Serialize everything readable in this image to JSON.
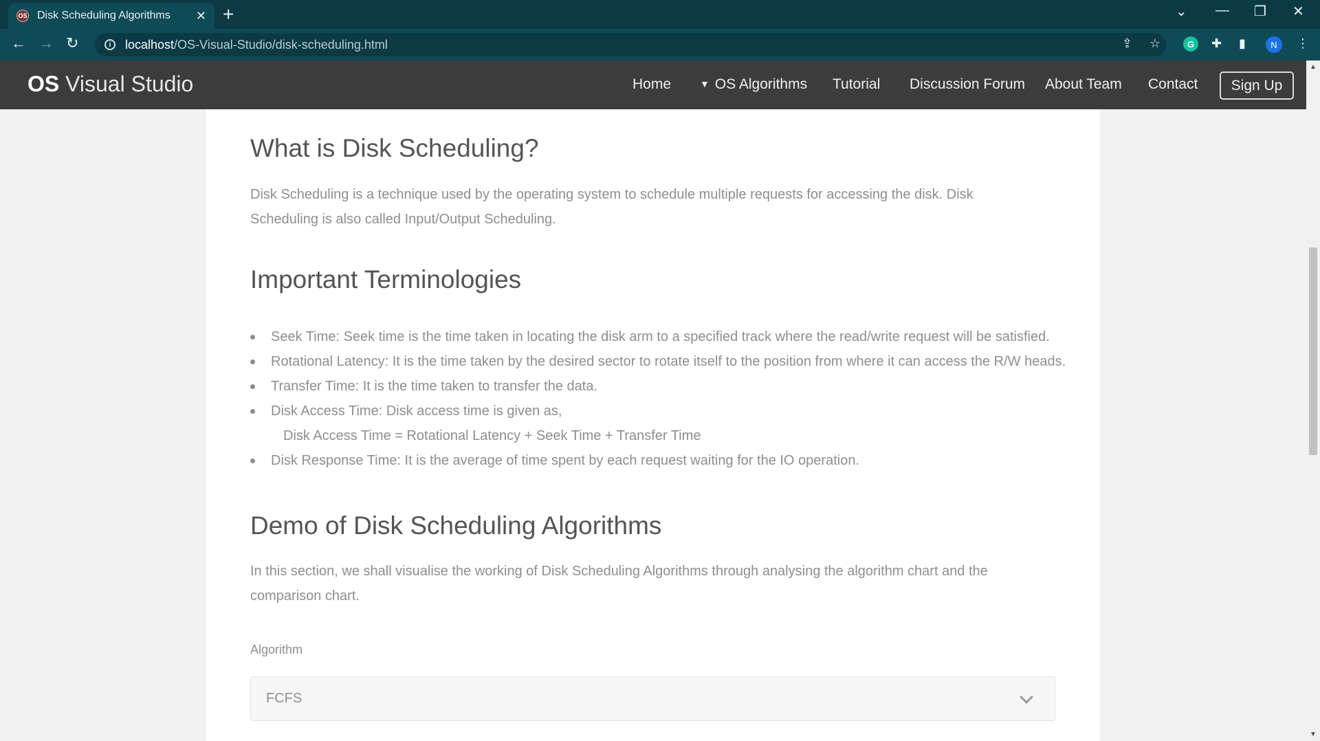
{
  "browser": {
    "tab_title": "Disk Scheduling Algorithms",
    "favicon_text": "OS",
    "url_host": "localhost",
    "url_path": "/OS-Visual-Studio/disk-scheduling.html",
    "grammarly_letter": "G",
    "profile_letter": "N"
  },
  "site": {
    "brand_bold": "OS",
    "brand_rest": " Visual Studio",
    "nav": {
      "home": "Home",
      "os_algorithms": "OS Algorithms",
      "tutorial": "Tutorial",
      "discussion": "Discussion Forum",
      "about": "About Team",
      "contact": "Contact",
      "signup": "Sign Up"
    }
  },
  "content": {
    "what_heading": "What is Disk Scheduling?",
    "what_text": "Disk Scheduling is a technique used by the operating system to schedule multiple requests for accessing the disk. Disk Scheduling is also called Input/Output Scheduling.",
    "terms_heading": "Important Terminologies",
    "terms": [
      "Seek Time: Seek time is the time taken in locating the disk arm to a specified track where the read/write request will be satisfied.",
      "Rotational Latency: It is the time taken by the desired sector to rotate itself to the position from where it can access the R/W heads.",
      "Transfer Time: It is the time taken to transfer the data.",
      "Disk Access Time: Disk access time is given as,",
      "Disk Access Time = Rotational Latency + Seek Time + Transfer Time",
      "Disk Response Time: It is the average of time spent by each request waiting for the IO operation."
    ],
    "demo_heading": "Demo of Disk Scheduling Algorithms",
    "demo_text": "In this section, we shall visualise the working of Disk Scheduling Algorithms through analysing the algorithm chart and the comparison chart.",
    "algorithm_label": "Algorithm",
    "algorithm_selected": "FCFS"
  },
  "colors": {
    "browser_frame": "#0b3a45",
    "navbar": "#3c3c3c",
    "text_muted": "#8e8e8e",
    "heading": "#545454"
  }
}
